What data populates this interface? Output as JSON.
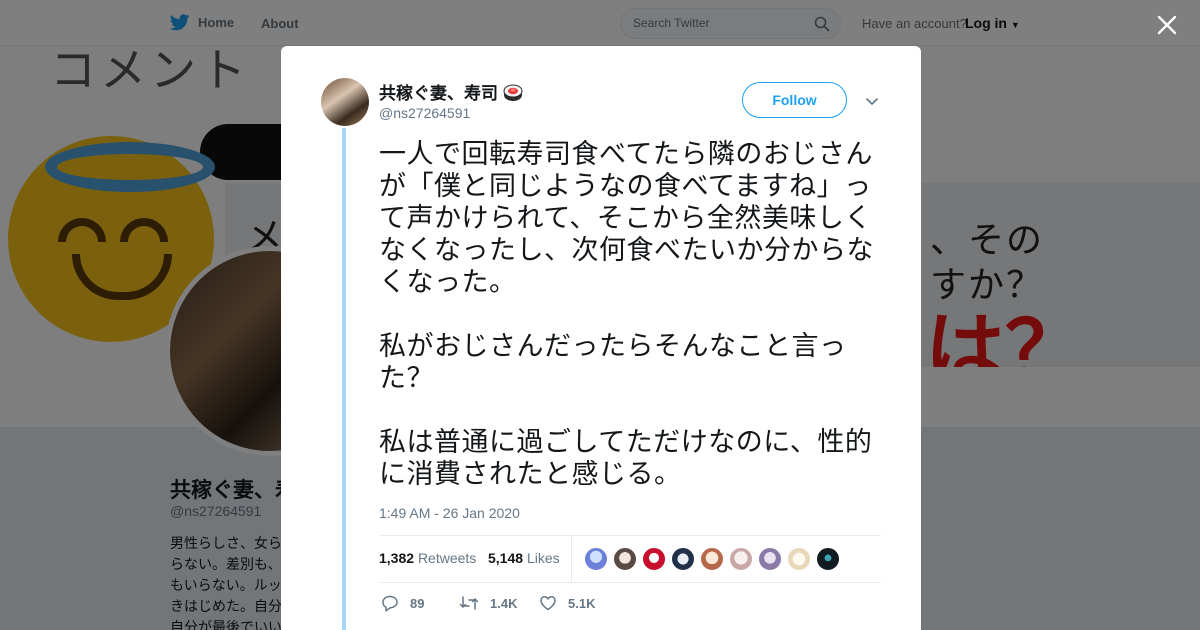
{
  "topbar": {
    "home_label": "Home",
    "about_label": "About",
    "search_placeholder": "Search Twitter",
    "account_prompt": "Have an account?",
    "login_label": "Log in"
  },
  "profile": {
    "name": "共稼ぐ妻、寿司",
    "handle": "@ns27264591",
    "bio_lines": [
      "男性らしさ、女ら",
      "らない。差別も、",
      "もいらない。ルッ",
      "きはじめた。自分",
      "自分が最後でいい"
    ]
  },
  "tweet": {
    "name": "共稼ぐ妻、寿司",
    "name_emoji_icon": "sushi-icon",
    "handle": "@ns27264591",
    "follow_label": "Follow",
    "paragraphs": [
      "一人で回転寿司食べてたら隣のおじさんが「僕と同じようなの食べてますね」って声かけられて、そこから全然美味しくなくなったし、次何食べたいか分からなくなった。",
      "私がおじさんだったらそんなこと言った？",
      "私は普通に過ごしてただけなのに、性的に消費されたと感じる。"
    ],
    "timestamp": "1:49 AM - 26 Jan 2020",
    "retweets_count": "1,382",
    "retweets_label": "Retweets",
    "likes_count": "5,148",
    "likes_label": "Likes",
    "reply_count": "89",
    "retweet_count_short": "1.4K",
    "like_count_short": "5.1K"
  },
  "colors": {
    "accent": "#1da1f2",
    "thread_line": "#a6d6f5",
    "text_secondary": "#657786"
  }
}
